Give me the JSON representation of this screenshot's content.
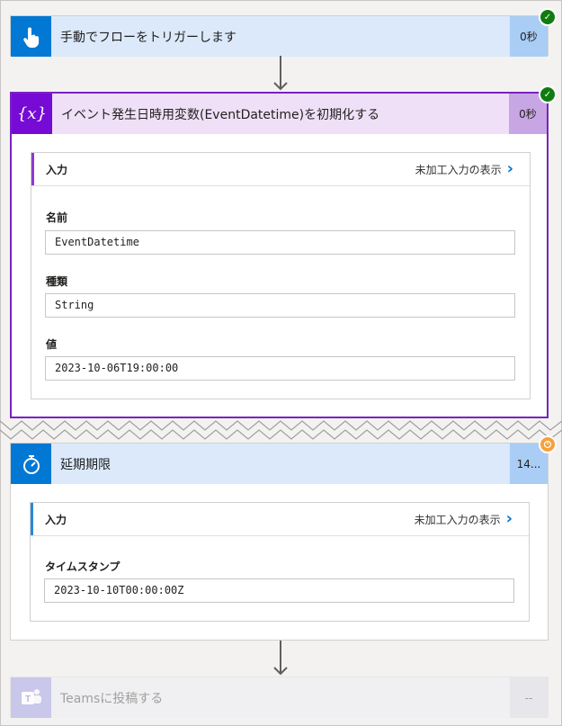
{
  "steps": {
    "trigger": {
      "title": "手動でフローをトリガーします",
      "duration": "0秒",
      "status": "succeeded"
    },
    "init_var": {
      "title": "イベント発生日時用変数(EventDatetime)を初期化する",
      "duration": "0秒",
      "status": "succeeded",
      "inputs_label": "入力",
      "show_raw_label": "未加工入力の表示",
      "fields": [
        {
          "label": "名前",
          "value": "EventDatetime"
        },
        {
          "label": "種類",
          "value": "String"
        },
        {
          "label": "値",
          "value": "2023-10-06T19:00:00"
        }
      ]
    },
    "delay": {
      "title": "延期期限",
      "duration": "14...",
      "status": "running",
      "inputs_label": "入力",
      "show_raw_label": "未加工入力の表示",
      "fields": [
        {
          "label": "タイムスタンプ",
          "value": "2023-10-10T00:00:00Z"
        }
      ]
    },
    "teams": {
      "title": "Teamsに投稿する",
      "duration": "--",
      "status": "not-run"
    }
  },
  "colors": {
    "trigger_icon": "#0078d4",
    "trigger_header": "#dbe9fb",
    "trigger_duration": "#a9cdf5",
    "var_icon": "#770bd6",
    "var_header": "#efe0f7",
    "var_duration": "#c8a5e3",
    "var_border": "#7a22c2",
    "delay_icon": "#0078d4",
    "delay_header": "#dbe9fb",
    "delay_duration": "#a9cdf5",
    "teams_icon": "#b9b7e0",
    "teams_header": "#f0f0f3",
    "success": "#107c10",
    "running": "#f7a03b"
  }
}
